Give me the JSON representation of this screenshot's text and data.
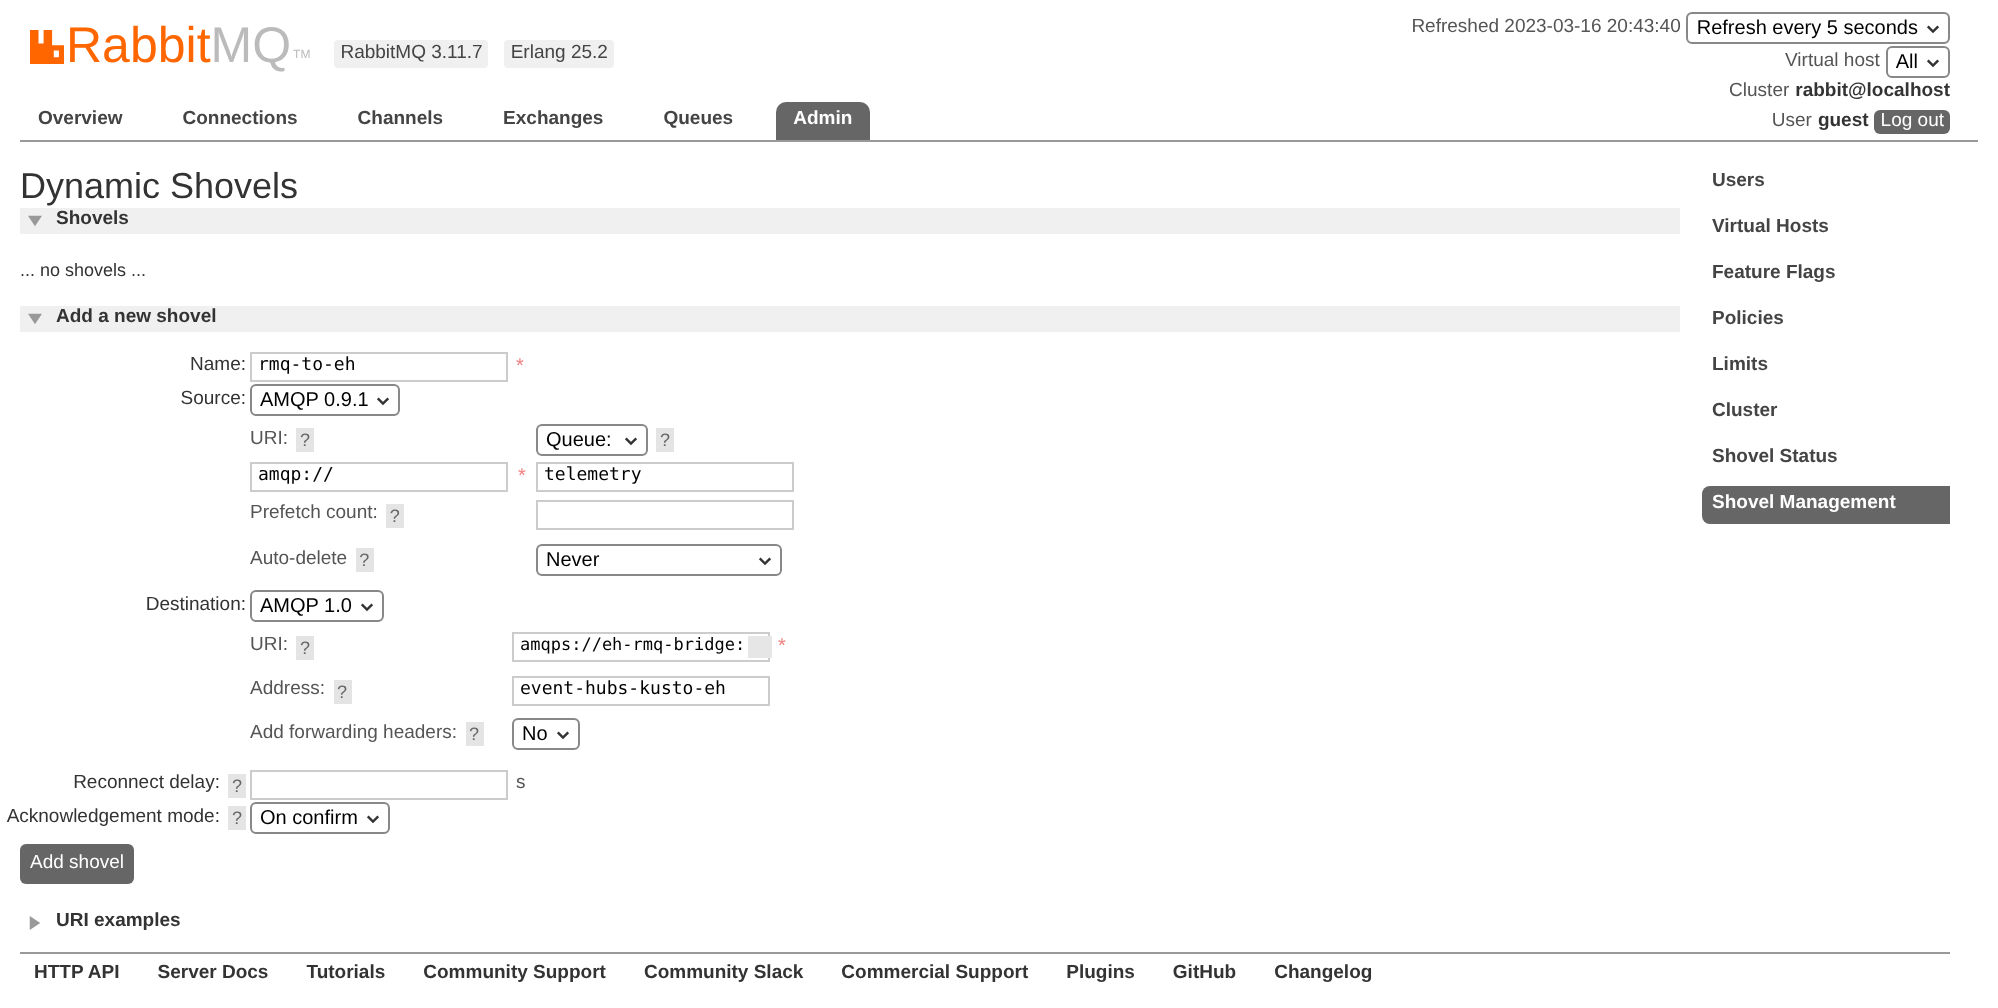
{
  "logo": {
    "brand": "Rabbit",
    "suffix": "MQ",
    "tm": "TM"
  },
  "versions": [
    "RabbitMQ 3.11.7",
    "Erlang 25.2"
  ],
  "status": {
    "refreshed": "Refreshed 2023-03-16 20:43:40",
    "refresh_select": "Refresh every 5 seconds",
    "vhost_label": "Virtual host",
    "vhost_select": "All",
    "cluster_label": "Cluster",
    "cluster": "rabbit@localhost",
    "user_label": "User",
    "user": "guest",
    "logout": "Log out"
  },
  "tabs": [
    {
      "label": "Overview",
      "selected": false
    },
    {
      "label": "Connections",
      "selected": false
    },
    {
      "label": "Channels",
      "selected": false
    },
    {
      "label": "Exchanges",
      "selected": false
    },
    {
      "label": "Queues",
      "selected": false
    },
    {
      "label": "Admin",
      "selected": true
    }
  ],
  "page_title": "Dynamic Shovels",
  "shovels_section": {
    "title": "Shovels",
    "expanded": true,
    "empty_text": "... no shovels ..."
  },
  "add_section": {
    "title": "Add a new shovel",
    "expanded": true
  },
  "form": {
    "name": {
      "label": "Name:",
      "value": "rmq-to-eh",
      "required_mark": "*"
    },
    "source": {
      "label": "Source:",
      "protocol": "AMQP 0.9.1",
      "uri": {
        "label": "URI:",
        "help": "?",
        "value": "amqp://",
        "required_mark": "*"
      },
      "endpoint": {
        "type": "Queue:",
        "help": "?",
        "value": "telemetry"
      },
      "prefetch": {
        "label": "Prefetch count:",
        "help": "?"
      },
      "auto_delete": {
        "label": "Auto-delete",
        "help": "?",
        "value": "Never"
      }
    },
    "destination": {
      "label": "Destination:",
      "protocol": "AMQP 1.0",
      "uri": {
        "label": "URI:",
        "help": "?",
        "value": "amqps://eh-rmq-bridge:",
        "redacted": true,
        "required_mark": "*"
      },
      "address": {
        "label": "Address:",
        "help": "?",
        "value": "event-hubs-kusto-eh"
      },
      "forwarding_headers": {
        "label": "Add forwarding headers:",
        "help": "?",
        "value": "No"
      }
    },
    "reconnect_delay": {
      "label": "Reconnect delay:",
      "help": "?",
      "unit": "s"
    },
    "ack_mode": {
      "label": "Acknowledgement mode:",
      "help": "?",
      "value": "On confirm"
    },
    "submit": "Add shovel"
  },
  "uri_examples": {
    "title": "URI examples",
    "expanded": false
  },
  "sidebar": [
    {
      "label": "Users",
      "selected": false
    },
    {
      "label": "Virtual Hosts",
      "selected": false
    },
    {
      "label": "Feature Flags",
      "selected": false
    },
    {
      "label": "Policies",
      "selected": false
    },
    {
      "label": "Limits",
      "selected": false
    },
    {
      "label": "Cluster",
      "selected": false
    },
    {
      "label": "Shovel Status",
      "selected": false
    },
    {
      "label": "Shovel Management",
      "selected": true
    }
  ],
  "footer": [
    "HTTP API",
    "Server Docs",
    "Tutorials",
    "Community Support",
    "Community Slack",
    "Commercial Support",
    "Plugins",
    "GitHub",
    "Changelog"
  ]
}
